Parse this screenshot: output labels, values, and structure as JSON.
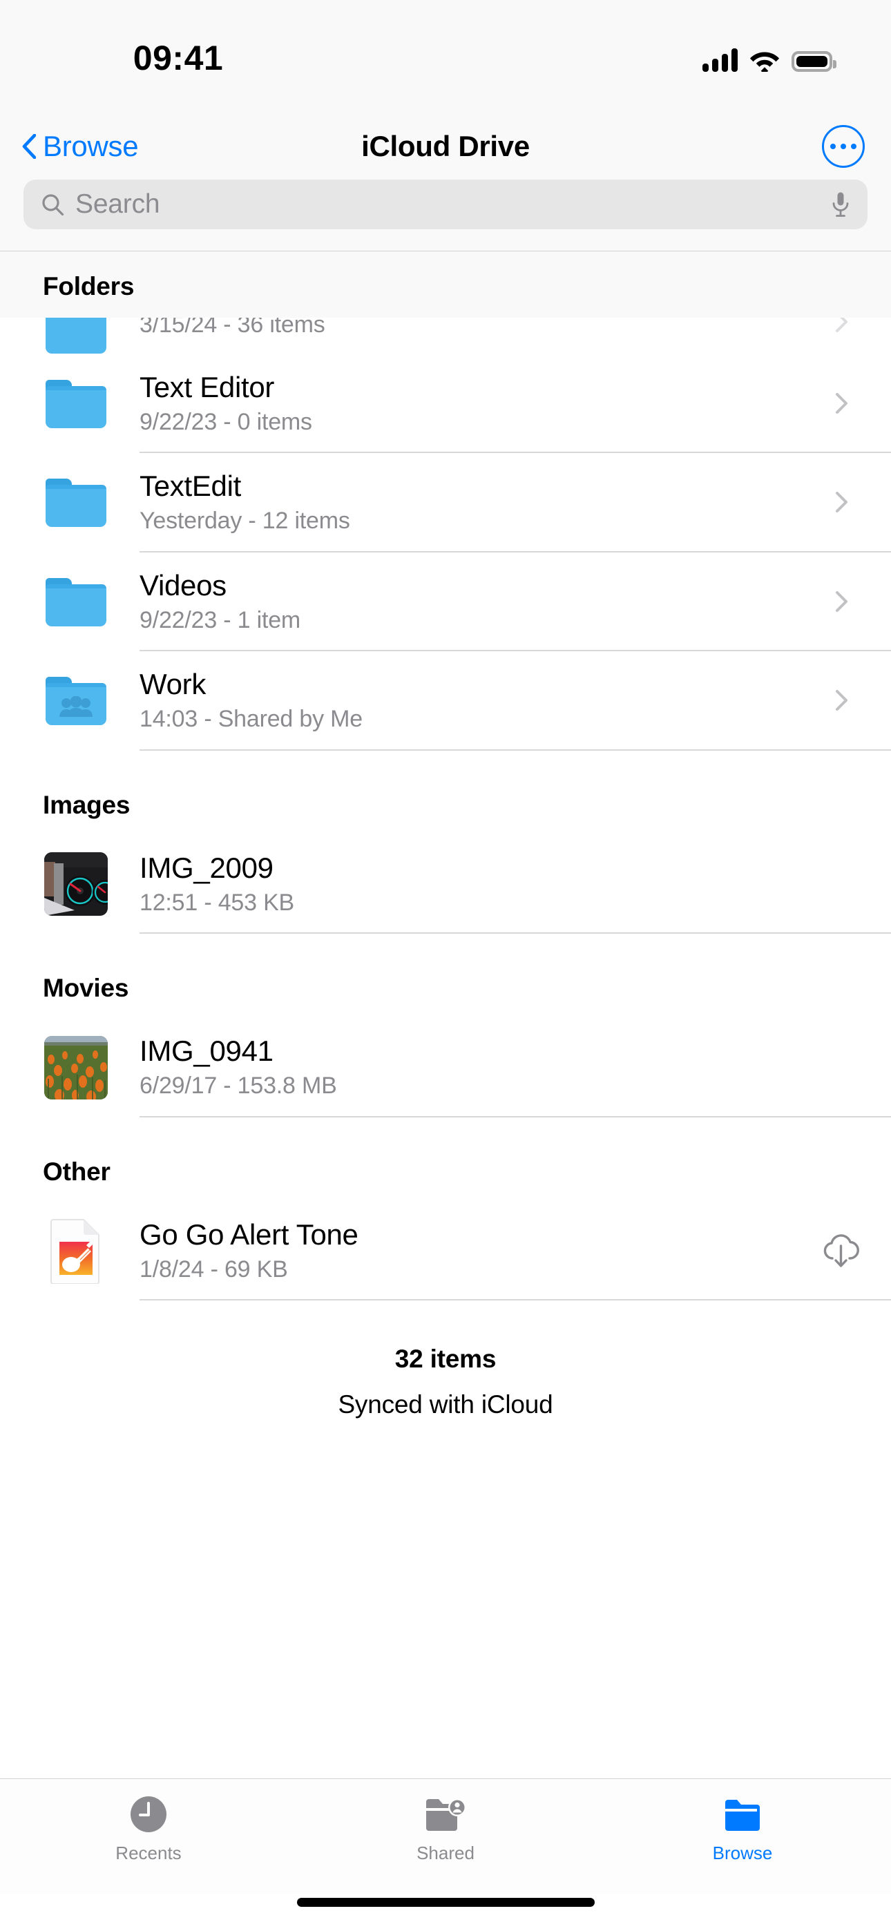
{
  "status_bar": {
    "time": "09:41",
    "cellular_icon": "cellular-signal-icon",
    "wifi_icon": "wifi-icon",
    "battery_icon": "battery-full-icon"
  },
  "nav": {
    "back_label": "Browse",
    "back_icon": "chevron-left-icon",
    "title": "iCloud Drive",
    "more_icon": "ellipsis-circle-icon"
  },
  "search": {
    "placeholder": "Search",
    "value": "",
    "search_icon": "search-icon",
    "mic_icon": "microphone-icon"
  },
  "colors": {
    "accent": "#007aff",
    "folder": "#4fb9ef",
    "separator": "#d8d8da",
    "secondary_text": "#8b8b8f",
    "header_bg": "#f9f9f9"
  },
  "sections": [
    {
      "title": "Folders",
      "sticky": true,
      "items": [
        {
          "name": "",
          "detail": "3/15/24 - 36 items",
          "icon": "folder-icon",
          "accessory": "chevron-right-icon",
          "clipped": true
        },
        {
          "name": "Text Editor",
          "detail": "9/22/23 - 0 items",
          "icon": "folder-icon",
          "accessory": "chevron-right-icon"
        },
        {
          "name": "TextEdit",
          "detail": "Yesterday - 12 items",
          "icon": "folder-icon",
          "accessory": "chevron-right-icon"
        },
        {
          "name": "Videos",
          "detail": "9/22/23 - 1 item",
          "icon": "folder-icon",
          "accessory": "chevron-right-icon"
        },
        {
          "name": "Work",
          "detail": "14:03 - Shared by Me",
          "icon": "shared-folder-icon",
          "accessory": "chevron-right-icon"
        }
      ]
    },
    {
      "title": "Images",
      "sticky": false,
      "items": [
        {
          "name": "IMG_2009",
          "detail": "12:51 - 453 KB",
          "icon": "photo-thumbnail-dashboard",
          "accessory": ""
        }
      ]
    },
    {
      "title": "Movies",
      "sticky": false,
      "items": [
        {
          "name": "IMG_0941",
          "detail": "6/29/17 - 153.8 MB",
          "icon": "video-thumbnail-flowers",
          "accessory": ""
        }
      ]
    },
    {
      "title": "Other",
      "sticky": false,
      "items": [
        {
          "name": "Go Go Alert Tone",
          "detail": "1/8/24 - 69 KB",
          "icon": "garageband-document-icon",
          "accessory": "icloud-download-icon"
        }
      ]
    }
  ],
  "footer": {
    "count": "32 items",
    "sync_status": "Synced with iCloud"
  },
  "tabbar": {
    "tabs": [
      {
        "label": "Recents",
        "icon": "clock-icon",
        "active": false
      },
      {
        "label": "Shared",
        "icon": "shared-folder-person-icon",
        "active": false
      },
      {
        "label": "Browse",
        "icon": "folder-icon",
        "active": true
      }
    ]
  },
  "home_indicator": "home-indicator"
}
